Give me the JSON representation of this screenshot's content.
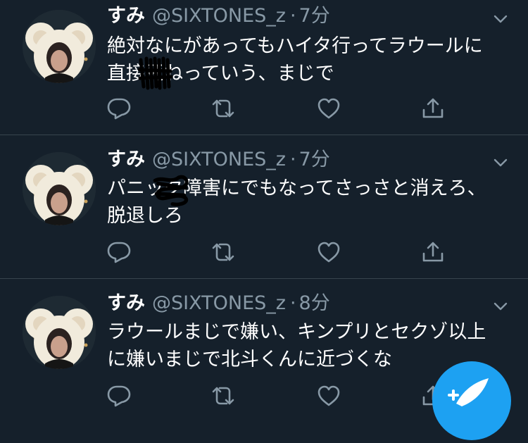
{
  "tweets": [
    {
      "name": "すみ",
      "handle": "@SIXTONES_z",
      "sep": "·",
      "time": "7分",
      "line1": "絶対なにがあってもハイタ行ってラウールに",
      "line2": "直接死ねっていう、まじで"
    },
    {
      "name": "すみ",
      "handle": "@SIXTONES_z",
      "sep": "·",
      "time": "7分",
      "line1": "パニック障害にでもなってさっさと消えろ、",
      "line2": "脱退しろ"
    },
    {
      "name": "すみ",
      "handle": "@SIXTONES_z",
      "sep": "·",
      "time": "8分",
      "line1": "ラウールまじで嫌い、キンプリとセクゾ以上",
      "line2": "に嫌いまじで北斗くんに近づくな"
    }
  ],
  "icons": {
    "reply": "reply-icon",
    "retweet": "retweet-icon",
    "like": "heart-icon",
    "share": "share-icon",
    "more": "chevron-down-icon",
    "compose": "compose-icon"
  },
  "colors": {
    "background": "#15202b",
    "muted": "#8899a6",
    "divider": "#38444d",
    "accent": "#1da1f2"
  }
}
